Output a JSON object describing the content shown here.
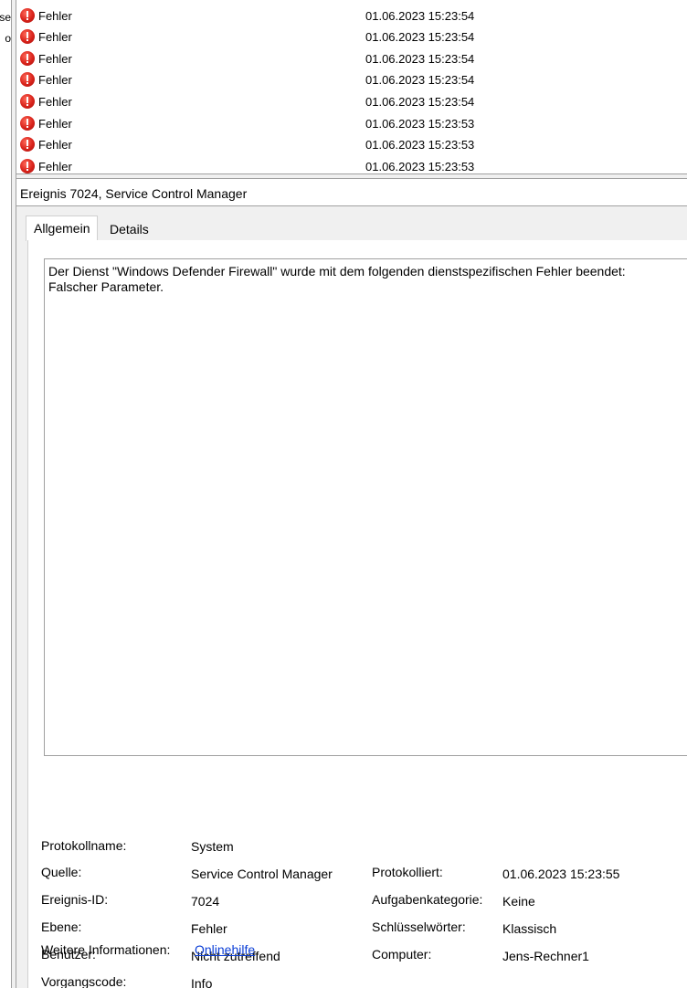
{
  "left_strip": {
    "fragments": [
      "se",
      "o"
    ]
  },
  "event_list": {
    "rows": [
      {
        "level": "Fehler",
        "date": "01.06.2023 15:23:54"
      },
      {
        "level": "Fehler",
        "date": "01.06.2023 15:23:54"
      },
      {
        "level": "Fehler",
        "date": "01.06.2023 15:23:54"
      },
      {
        "level": "Fehler",
        "date": "01.06.2023 15:23:54"
      },
      {
        "level": "Fehler",
        "date": "01.06.2023 15:23:54"
      },
      {
        "level": "Fehler",
        "date": "01.06.2023 15:23:53"
      },
      {
        "level": "Fehler",
        "date": "01.06.2023 15:23:53"
      },
      {
        "level": "Fehler",
        "date": "01.06.2023 15:23:53"
      }
    ]
  },
  "detail": {
    "header": "Ereignis 7024, Service Control Manager",
    "tabs": [
      {
        "label": "Allgemein"
      },
      {
        "label": "Details"
      }
    ],
    "description": "Der Dienst \"Windows Defender Firewall\" wurde mit dem folgenden dienstspezifischen Fehler beendet: \nFalscher Parameter.",
    "properties": {
      "protokollname_label": "Protokollname:",
      "protokollname_value": "System",
      "quelle_label": "Quelle:",
      "quelle_value": "Service Control Manager",
      "protokolliert_label": "Protokolliert:",
      "protokolliert_value": "01.06.2023 15:23:55",
      "ereignis_id_label": "Ereignis-ID:",
      "ereignis_id_value": "7024",
      "aufgabenkategorie_label": "Aufgabenkategorie:",
      "aufgabenkategorie_value": "Keine",
      "ebene_label": "Ebene:",
      "ebene_value": "Fehler",
      "schluesselwoerter_label": "Schlüsselwörter:",
      "schluesselwoerter_value": "Klassisch",
      "benutzer_label": "Benutzer:",
      "benutzer_value": "Nicht zutreffend",
      "computer_label": "Computer:",
      "computer_value": "Jens-Rechner1",
      "vorgangscode_label": "Vorgangscode:",
      "vorgangscode_value": "Info",
      "weitere_label": "Weitere Informationen:",
      "weitere_link": "Onlinehilfe"
    }
  },
  "colors": {
    "error_red": "#d8221a",
    "link_blue": "#0b3ed6",
    "pane_bg": "#f0f0f0"
  },
  "icons": {
    "row_icon": "error-icon"
  }
}
